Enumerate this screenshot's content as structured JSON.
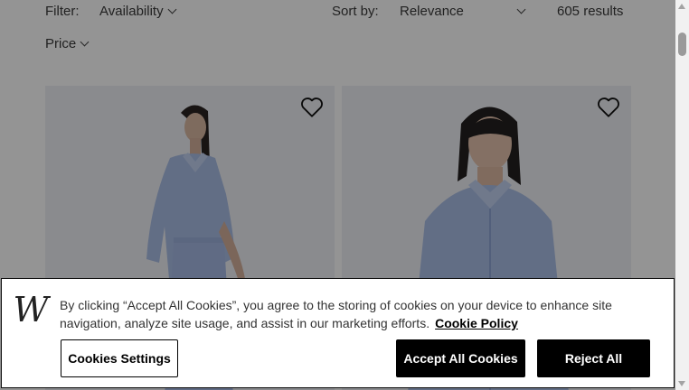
{
  "filters": {
    "filter_label": "Filter:",
    "availability_label": "Availability",
    "price_label": "Price",
    "sort_label": "Sort by:",
    "sort_value": "Relevance",
    "results": "605 results"
  },
  "products": [
    {
      "name": "product-card-1"
    },
    {
      "name": "product-card-2"
    }
  ],
  "cookie_banner": {
    "logo_letter": "W",
    "message": "By clicking “Accept All Cookies”, you agree to the storing of cookies on your device to enhance site navigation, analyze site usage, and assist in our marketing efforts.",
    "policy_link": "Cookie Policy",
    "settings_button": "Cookies Settings",
    "accept_button": "Accept All Cookies",
    "reject_button": "Reject All"
  },
  "colors": {
    "overlay": "rgba(0,0,0,0.42)",
    "button_dark": "#000000",
    "card_bg": "#eef0f4",
    "shirt_blue": "#a9bde6"
  }
}
